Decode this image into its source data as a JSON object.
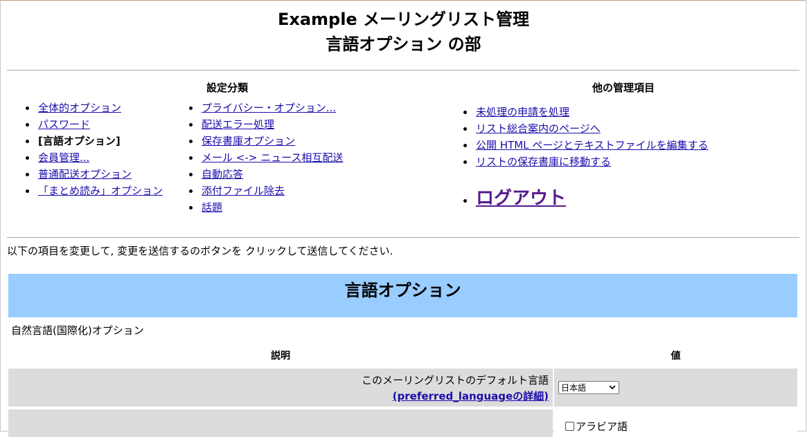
{
  "header": {
    "title": "Example メーリングリスト管理",
    "subtitle": "言語オプション の部"
  },
  "categories": {
    "heading": "設定分類",
    "col1": [
      {
        "label": "全体的オプション",
        "current": false
      },
      {
        "label": "パスワード",
        "current": false
      },
      {
        "label": "[言語オプション]",
        "current": true
      },
      {
        "label": "会員管理...",
        "current": false
      },
      {
        "label": "普通配送オプション",
        "current": false
      },
      {
        "label": "「まとめ読み」オプション",
        "current": false
      }
    ],
    "col2": [
      {
        "label": "プライバシー・オプション..."
      },
      {
        "label": "配送エラー処理"
      },
      {
        "label": "保存書庫オプション"
      },
      {
        "label": "メール <-> ニュース相互配送"
      },
      {
        "label": "自動応答"
      },
      {
        "label": "添付ファイル除去"
      },
      {
        "label": "話題"
      }
    ]
  },
  "other": {
    "heading": "他の管理項目",
    "items": [
      {
        "label": "未処理の申請を処理"
      },
      {
        "label": "リスト総合案内のページへ"
      },
      {
        "label": "公開 HTML ページとテキストファイルを編集する"
      },
      {
        "label": "リストの保存書庫に移動する"
      }
    ],
    "logout": "ログアウト"
  },
  "instructions": "以下の項目を変更して, 変更を送信するのボタンを クリックして送信してください.",
  "section": {
    "title": "言語オプション",
    "subtitle": "自然言語(国際化)オプション",
    "col_description": "説明",
    "col_value": "値"
  },
  "rows": [
    {
      "description": "このメーリングリストのデフォルト言語",
      "detail_link": "(preferred_languageの詳細)",
      "select_value": "日本語"
    },
    {
      "checkbox_label": "アラビア語",
      "checked": false
    }
  ],
  "colors": {
    "link": "#1a0dab",
    "visited_link": "#551a8b",
    "section_bg": "#99ccff",
    "row_bg": "#dcdcdc"
  }
}
